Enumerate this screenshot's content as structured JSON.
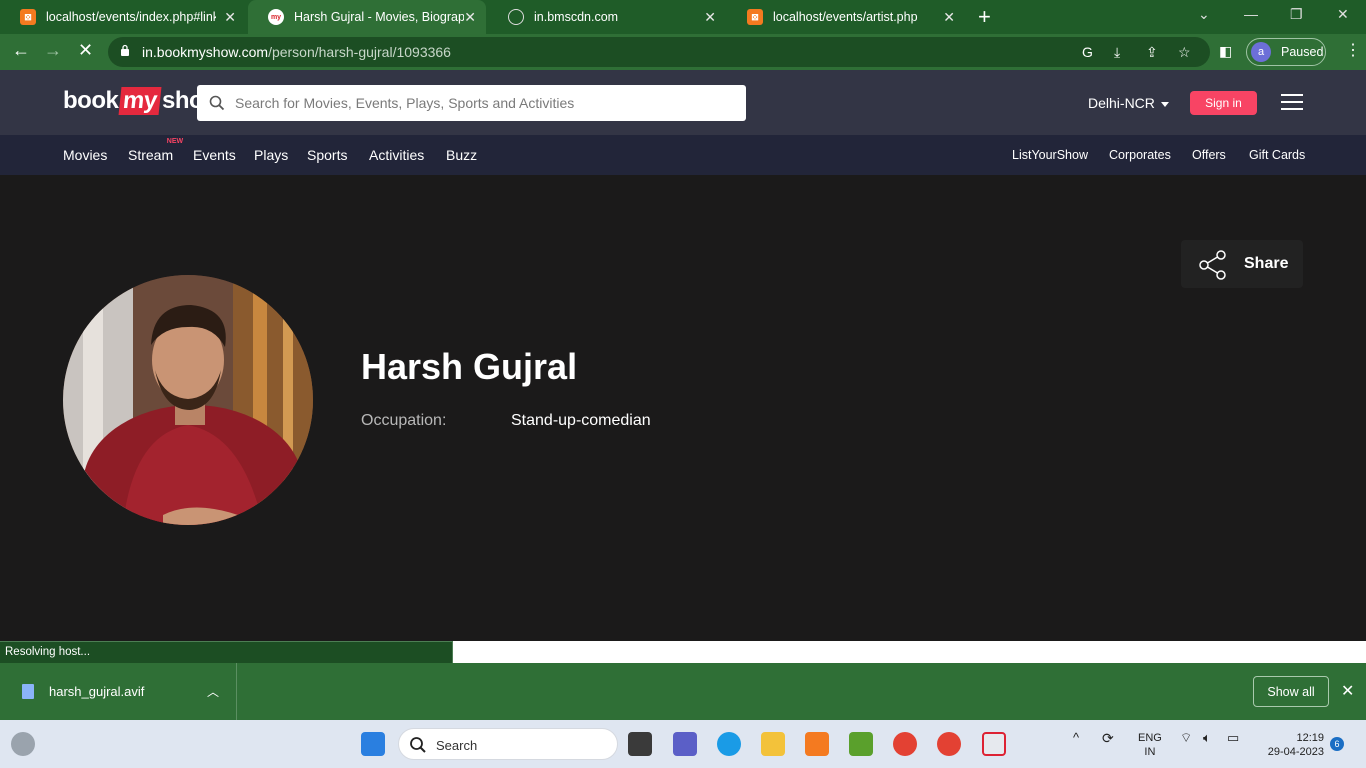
{
  "browser": {
    "tabs": [
      {
        "title": "localhost/events/index.php#link",
        "favicon": "xampp-icon"
      },
      {
        "title": "Harsh Gujral - Movies, Biography",
        "favicon": "bookmyshow-icon"
      },
      {
        "title": "in.bmscdn.com",
        "favicon": "globe-icon"
      },
      {
        "title": "localhost/events/artist.php",
        "favicon": "xampp-icon"
      }
    ],
    "url_host": "in.bookmyshow.com",
    "url_path": "/person/harsh-gujral/1093366",
    "profile_initial": "a",
    "profile_status": "Paused",
    "status_text": "Resolving host..."
  },
  "site": {
    "logo_pre": "book",
    "logo_mid": "my",
    "logo_post": "show",
    "search_placeholder": "Search for Movies, Events, Plays, Sports and Activities",
    "city": "Delhi-NCR",
    "signin_label": "Sign in",
    "nav_left": [
      "Movies",
      "Stream",
      "Events",
      "Plays",
      "Sports",
      "Activities",
      "Buzz"
    ],
    "new_badge": "NEW",
    "nav_right": [
      "ListYourShow",
      "Corporates",
      "Offers",
      "Gift Cards"
    ],
    "accent": "#f84464"
  },
  "person": {
    "share_label": "Share",
    "name": "Harsh Gujral",
    "occupation_label": "Occupation:",
    "occupation_value": "Stand-up-comedian"
  },
  "downloads": {
    "file_name": "harsh_gujral.avif",
    "show_all_label": "Show all"
  },
  "taskbar": {
    "search_label": "Search",
    "lang_1": "ENG",
    "lang_2": "IN",
    "time": "12:19",
    "date": "29-04-2023",
    "notification_count": "6"
  }
}
